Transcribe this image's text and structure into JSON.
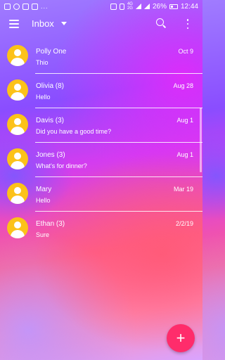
{
  "status_bar": {
    "notification_more": "...",
    "battery_percent": "26%",
    "time": "12:44",
    "net_top": "4G",
    "net_bottom": "2G"
  },
  "app_bar": {
    "title": "Inbox",
    "icons": [
      "menu-icon",
      "dropdown-icon",
      "search-icon",
      "more-vert-icon"
    ]
  },
  "conversations": [
    {
      "name": "Polly One",
      "preview": "Thio",
      "date": "Oct 9"
    },
    {
      "name": "Olivia (8)",
      "preview": "Hello",
      "date": "Aug 28"
    },
    {
      "name": "Davis (3)",
      "preview": "Did you have a good time?",
      "date": "Aug 1"
    },
    {
      "name": "Jones (3)",
      "preview": "What's for dinner?",
      "date": "Aug 1"
    },
    {
      "name": "Mary",
      "preview": "Hello",
      "date": "Mar 19"
    },
    {
      "name": "Ethan (3)",
      "preview": "Sure",
      "date": "2/2/19"
    }
  ],
  "fab": {
    "label": "+"
  },
  "colors": {
    "avatar": "#fcc219",
    "fab": "#ff2c6b",
    "text": "#ffffff"
  }
}
